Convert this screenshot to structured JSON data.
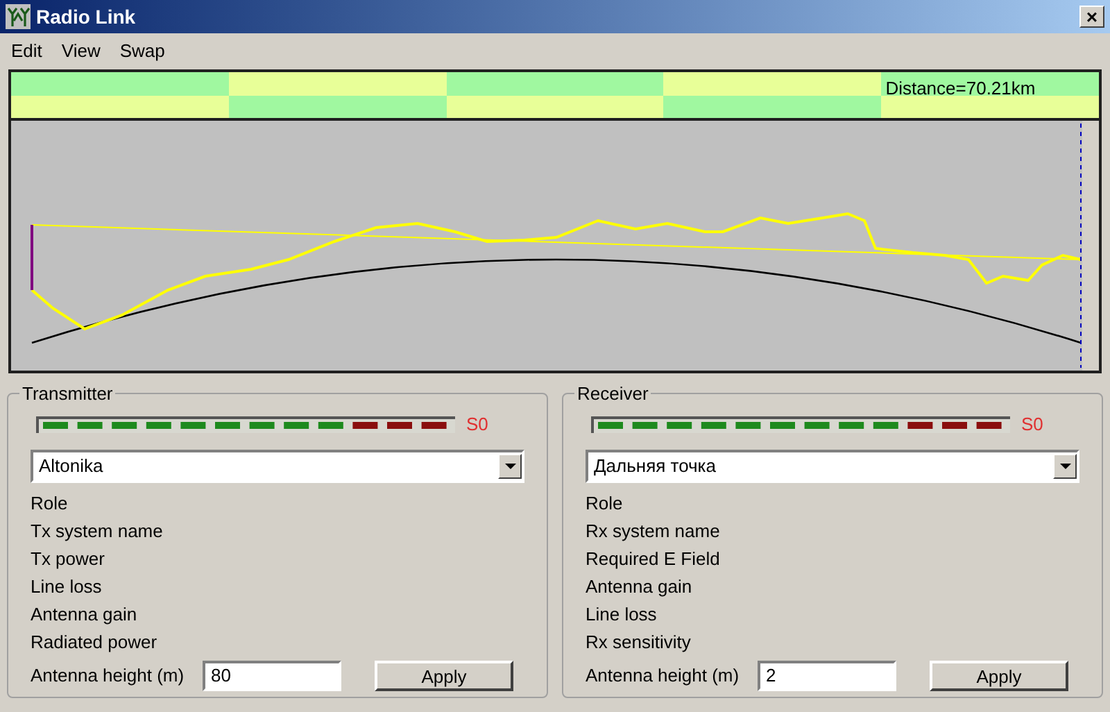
{
  "window": {
    "title": "Radio Link",
    "close": "×"
  },
  "menu": [
    "Edit",
    "View",
    "Swap"
  ],
  "band": {
    "distance": "Distance=70.21km"
  },
  "panels": [
    {
      "title": "Transmitter",
      "meter_reading": "S0",
      "selection": "Altonika",
      "fields": [
        "Role",
        "Tx system name",
        "Tx power",
        "Line loss",
        "Antenna gain",
        "Radiated power"
      ],
      "height_label": "Antenna height (m)",
      "height_value": "80",
      "button": "Apply"
    },
    {
      "title": "Receiver",
      "meter_reading": "S0",
      "selection": "Дальняя точка",
      "fields": [
        "Role",
        "Rx system name",
        "Required E Field",
        "Antenna gain",
        "Line loss",
        "Rx sensitivity"
      ],
      "height_label": "Antenna height (m)",
      "height_value": "2",
      "button": "Apply"
    }
  ]
}
